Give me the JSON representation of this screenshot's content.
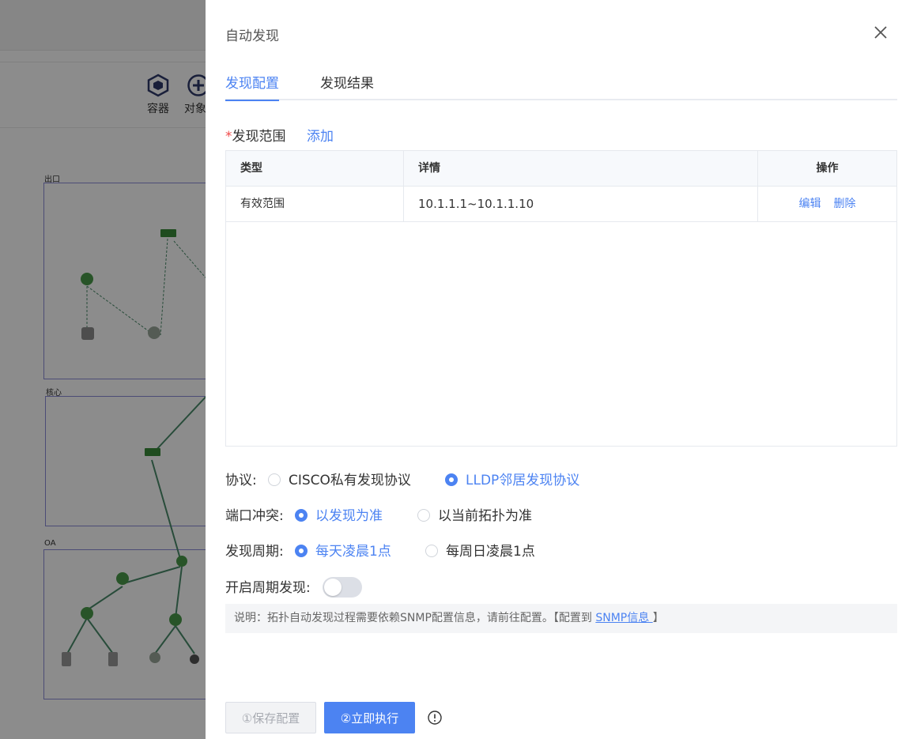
{
  "background": {
    "toolbar": [
      {
        "label": "容器",
        "icon": "container-icon"
      },
      {
        "label": "对象",
        "icon": "plus-icon"
      }
    ],
    "groups": [
      "出口",
      "核心",
      "OA"
    ]
  },
  "drawer": {
    "title": "自动发现",
    "close_icon": "close-icon",
    "tabs": [
      {
        "label": "发现配置",
        "active": true
      },
      {
        "label": "发现结果",
        "active": false
      }
    ],
    "scope": {
      "required_mark": "*",
      "label": "发现范围",
      "add_link": "添加",
      "columns": [
        "类型",
        "详情",
        "操作"
      ],
      "rows": [
        {
          "type": "有效范围",
          "detail": "10.1.1.1~10.1.1.10",
          "actions": [
            "编辑",
            "删除"
          ]
        }
      ]
    },
    "protocol": {
      "label": "协议:",
      "options": [
        {
          "label": "CISCO私有发现协议",
          "checked": false
        },
        {
          "label": "LLDP邻居发现协议",
          "checked": true
        }
      ]
    },
    "port_conflict": {
      "label": "端口冲突:",
      "options": [
        {
          "label": "以发现为准",
          "checked": true
        },
        {
          "label": "以当前拓扑为准",
          "checked": false
        }
      ]
    },
    "period": {
      "label": "发现周期:",
      "options": [
        {
          "label": "每天凌晨1点",
          "checked": true
        },
        {
          "label": "每周日凌晨1点",
          "checked": false
        }
      ]
    },
    "periodic_toggle": {
      "label": "开启周期发现:",
      "on": false
    },
    "note": {
      "prefix": "说明：拓扑自动发现过程需要依赖SNMP配置信息，请前往配置。【配置到 ",
      "link": "SNMP信息 ",
      "suffix": "】"
    },
    "buttons": {
      "save": "①保存配置",
      "run": "②立即执行"
    },
    "info_icon": "exclamation-circle-icon"
  },
  "colors": {
    "accent": "#4c83f2",
    "required": "#f04a4a"
  }
}
